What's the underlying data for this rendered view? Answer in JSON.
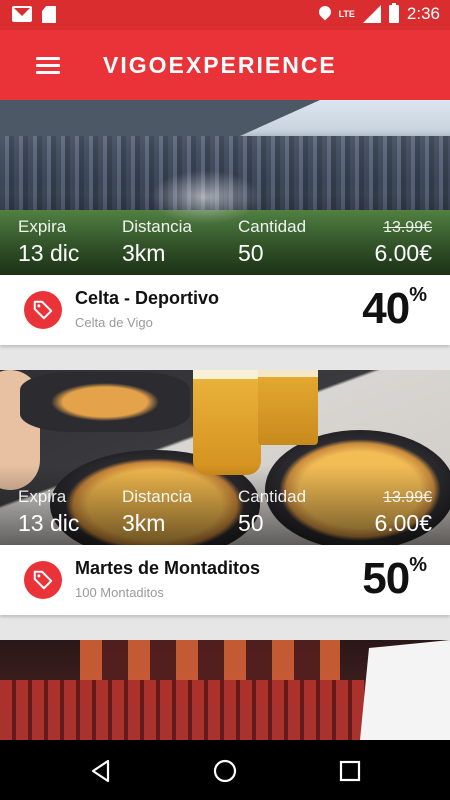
{
  "status_bar": {
    "time": "2:36",
    "network": "LTE",
    "icons": [
      "gmail-icon",
      "sd-card-icon",
      "location-icon",
      "lte-signal-icon",
      "battery-charging-icon"
    ]
  },
  "app_bar": {
    "title": "VIGOEXPERIENCE",
    "menu_icon": "hamburger-menu-icon",
    "color": "#ea3338"
  },
  "stat_labels": {
    "expira": "Expira",
    "distancia": "Distancia",
    "cantidad": "Cantidad"
  },
  "cards": [
    {
      "image": "stadium",
      "expira": "13 dic",
      "distancia": "3km",
      "cantidad": "50",
      "old_price": "13.99€",
      "price": "6.00€",
      "title": "Celta - Deportivo",
      "subtitle": "Celta de Vigo",
      "discount": "40",
      "discount_symbol": "%"
    },
    {
      "image": "food",
      "expira": "13 dic",
      "distancia": "3km",
      "cantidad": "50",
      "old_price": "13.99€",
      "price": "6.00€",
      "title": "Martes de Montaditos",
      "subtitle": "100 Montaditos",
      "discount": "50",
      "discount_symbol": "%"
    },
    {
      "image": "cinema"
    }
  ],
  "nav_bar": {
    "buttons": [
      "back-icon",
      "home-icon",
      "recent-apps-icon"
    ]
  },
  "colors": {
    "accent": "#ea3338",
    "status_bar": "#d92d30"
  }
}
